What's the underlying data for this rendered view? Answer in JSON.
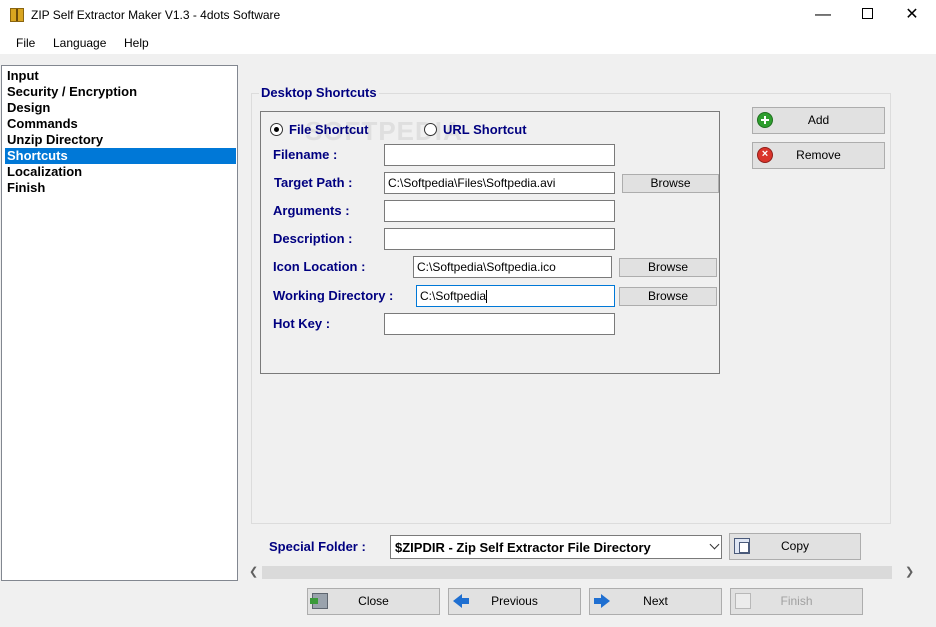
{
  "window": {
    "title": "ZIP Self Extractor Maker V1.3 - 4dots Software",
    "minimize_glyph": "—",
    "close_glyph": "✕"
  },
  "menu": {
    "items": [
      "File",
      "Language",
      "Help"
    ]
  },
  "sidebar": {
    "items": [
      {
        "label": "Input"
      },
      {
        "label": "Security / Encryption"
      },
      {
        "label": "Design"
      },
      {
        "label": "Commands"
      },
      {
        "label": "Unzip Directory"
      },
      {
        "label": "Shortcuts",
        "active": true
      },
      {
        "label": "Localization"
      },
      {
        "label": "Finish"
      }
    ]
  },
  "panel": {
    "title": "Desktop Shortcuts"
  },
  "shortcut_type": {
    "file_label": "File Shortcut",
    "url_label": "URL Shortcut",
    "selected": "file"
  },
  "fields": {
    "filename": {
      "label": "Filename :",
      "value": ""
    },
    "target_path": {
      "label": "Target Path :",
      "value": "C:\\Softpedia\\Files\\Softpedia.avi"
    },
    "arguments": {
      "label": "Arguments :",
      "value": ""
    },
    "description": {
      "label": "Description :",
      "value": ""
    },
    "icon_location": {
      "label": "Icon Location :",
      "value": "C:\\Softpedia\\Softpedia.ico"
    },
    "working_directory": {
      "label": "Working Directory :",
      "value": "C:\\Softpedia"
    },
    "hot_key": {
      "label": "Hot Key :",
      "value": ""
    }
  },
  "buttons": {
    "browse": "Browse",
    "add": "Add",
    "remove": "Remove",
    "copy": "Copy",
    "close": "Close",
    "previous": "Previous",
    "next": "Next",
    "finish": "Finish"
  },
  "special_folder": {
    "label": "Special Folder :",
    "selected": "$ZIPDIR - Zip Self Extractor File Directory"
  },
  "watermark": "SOFTPEDIA",
  "colors": {
    "label_blue": "#000080",
    "selection": "#0078d7"
  }
}
